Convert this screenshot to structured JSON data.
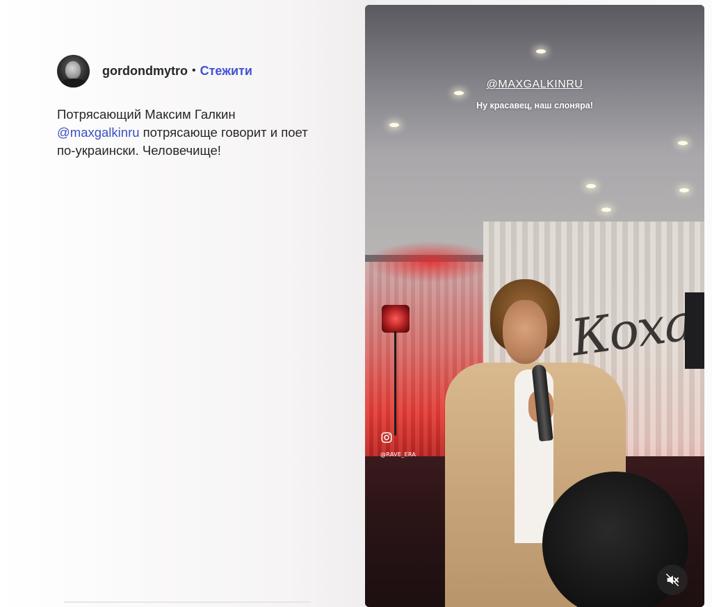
{
  "post": {
    "username": "gordondmytro",
    "separator": "•",
    "follow_label": "Стежити",
    "avatar_icon": "avatar-icon",
    "caption_part1": "Потрясающий Максим Галкин ",
    "caption_mention": "@maxgalkinru",
    "caption_part2": " потрясающе говорит и поет по-украински. Человечище!"
  },
  "video": {
    "overlay_mention": "@MAXGALKINRU",
    "overlay_caption": "Ну красавец, наш слоняра!",
    "stage_sign": "Кохана",
    "watermark_handle": "@RAVE_ERA",
    "watermark_icon": "instagram-icon",
    "mute_icon": "speaker-muted-icon"
  },
  "colors": {
    "link": "#4152d4",
    "text": "#262626"
  }
}
